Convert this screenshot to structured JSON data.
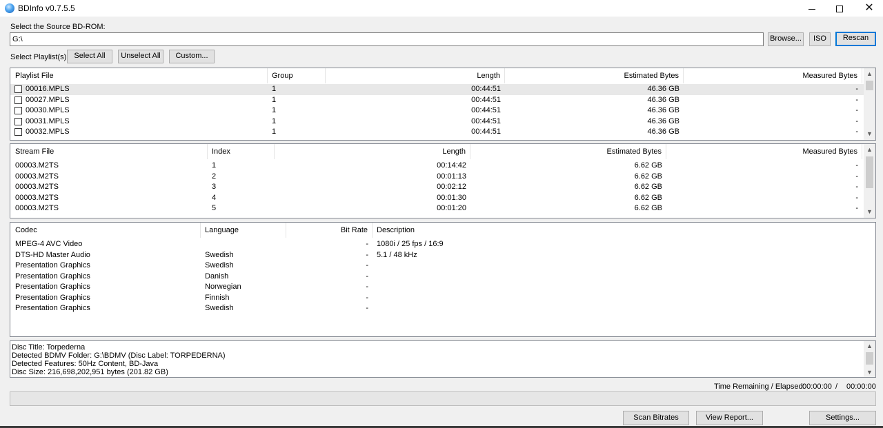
{
  "window": {
    "title": "BDInfo v0.7.5.5"
  },
  "source": {
    "label": "Select the Source BD-ROM:",
    "path": "G:\\",
    "browse_label": "Browse...",
    "iso_label": "ISO",
    "rescan_label": "Rescan"
  },
  "playlist_controls": {
    "label": "Select Playlist(s):",
    "select_all": "Select All",
    "unselect_all": "Unselect All",
    "custom": "Custom..."
  },
  "playlists": {
    "columns": [
      "Playlist File",
      "Group",
      "Length",
      "Estimated Bytes",
      "Measured Bytes"
    ],
    "rows": [
      {
        "file": "00016.MPLS",
        "group": "1",
        "length": "00:44:51",
        "estimated": "46.36 GB",
        "measured": "-"
      },
      {
        "file": "00027.MPLS",
        "group": "1",
        "length": "00:44:51",
        "estimated": "46.36 GB",
        "measured": "-"
      },
      {
        "file": "00030.MPLS",
        "group": "1",
        "length": "00:44:51",
        "estimated": "46.36 GB",
        "measured": "-"
      },
      {
        "file": "00031.MPLS",
        "group": "1",
        "length": "00:44:51",
        "estimated": "46.36 GB",
        "measured": "-"
      },
      {
        "file": "00032.MPLS",
        "group": "1",
        "length": "00:44:51",
        "estimated": "46.36 GB",
        "measured": "-"
      }
    ]
  },
  "streams": {
    "columns": [
      "Stream File",
      "Index",
      "Length",
      "Estimated Bytes",
      "Measured Bytes"
    ],
    "rows": [
      {
        "file": "00003.M2TS",
        "index": "1",
        "length": "00:14:42",
        "estimated": "6.62 GB",
        "measured": "-"
      },
      {
        "file": "00003.M2TS",
        "index": "2",
        "length": "00:01:13",
        "estimated": "6.62 GB",
        "measured": "-"
      },
      {
        "file": "00003.M2TS",
        "index": "3",
        "length": "00:02:12",
        "estimated": "6.62 GB",
        "measured": "-"
      },
      {
        "file": "00003.M2TS",
        "index": "4",
        "length": "00:01:30",
        "estimated": "6.62 GB",
        "measured": "-"
      },
      {
        "file": "00003.M2TS",
        "index": "5",
        "length": "00:01:20",
        "estimated": "6.62 GB",
        "measured": "-"
      }
    ]
  },
  "codecs": {
    "columns": [
      "Codec",
      "Language",
      "Bit Rate",
      "Description"
    ],
    "rows": [
      {
        "codec": "MPEG-4 AVC Video",
        "language": "",
        "bitrate": "-",
        "description": "1080i / 25 fps / 16:9"
      },
      {
        "codec": "DTS-HD Master Audio",
        "language": "Swedish",
        "bitrate": "-",
        "description": "5.1 / 48 kHz"
      },
      {
        "codec": "Presentation Graphics",
        "language": "Swedish",
        "bitrate": "-",
        "description": ""
      },
      {
        "codec": "Presentation Graphics",
        "language": "Danish",
        "bitrate": "-",
        "description": ""
      },
      {
        "codec": "Presentation Graphics",
        "language": "Norwegian",
        "bitrate": "-",
        "description": ""
      },
      {
        "codec": "Presentation Graphics",
        "language": "Finnish",
        "bitrate": "-",
        "description": ""
      },
      {
        "codec": "Presentation Graphics",
        "language": "Swedish",
        "bitrate": "-",
        "description": ""
      }
    ]
  },
  "disc_info": [
    "Disc Title: Torpederna",
    "Detected BDMV Folder: G:\\BDMV (Disc Label: TORPEDERNA)",
    "Detected Features: 50Hz Content, BD-Java",
    "Disc Size: 216,698,202,951 bytes (201.82 GB)"
  ],
  "status": {
    "time_label": "Time Remaining / Elapsed:",
    "remaining": "00:00:00",
    "separator": "/",
    "elapsed": "00:00:00"
  },
  "actions": {
    "scan_bitrates": "Scan Bitrates",
    "view_report": "View Report...",
    "settings": "Settings..."
  }
}
